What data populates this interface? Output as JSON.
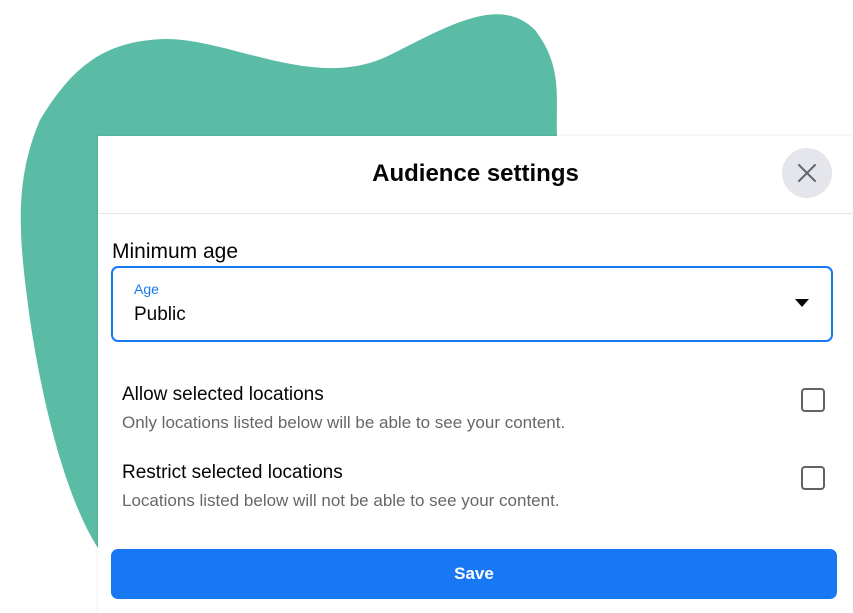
{
  "dialog": {
    "title": "Audience settings",
    "close_icon": "close-icon"
  },
  "minimum_age": {
    "label": "Minimum age",
    "select": {
      "caption": "Age",
      "value": "Public",
      "icon": "caret-down-icon"
    }
  },
  "locations": [
    {
      "title": "Allow selected locations",
      "description": "Only locations listed below will be able to see your content.",
      "checked": false
    },
    {
      "title": "Restrict selected locations",
      "description": "Locations listed below will not be able to see your content.",
      "checked": false
    }
  ],
  "save_button": {
    "label": "Save"
  },
  "colors": {
    "accent": "#1877f2",
    "blob": "#5bbca6",
    "close_button_bg": "#e4e6eb",
    "secondary_text": "#65676b"
  }
}
